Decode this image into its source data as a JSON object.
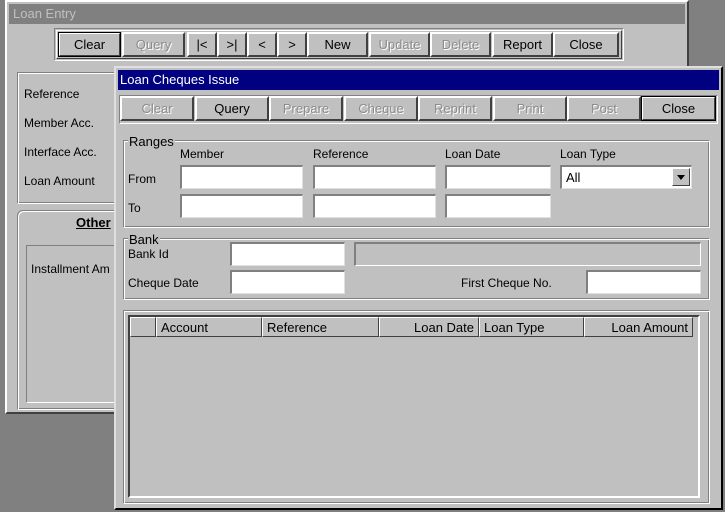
{
  "back_window": {
    "title": "Loan Entry",
    "toolbar": [
      {
        "label": "Clear",
        "enabled": true,
        "focused": true
      },
      {
        "label": "Query",
        "enabled": false
      },
      {
        "label": "|<",
        "enabled": true
      },
      {
        "label": ">|",
        "enabled": true
      },
      {
        "label": "<",
        "enabled": true
      },
      {
        "label": ">",
        "enabled": true
      },
      {
        "label": "New",
        "enabled": true
      },
      {
        "label": "Update",
        "enabled": false
      },
      {
        "label": "Delete",
        "enabled": false
      },
      {
        "label": "Report",
        "enabled": true
      },
      {
        "label": "Close",
        "enabled": true
      }
    ],
    "fields": {
      "reference": "Reference",
      "member_acc": "Member Acc.",
      "interface_acc": "Interface Acc.",
      "loan_amount": "Loan Amount"
    },
    "tab_label": "Other",
    "installment_label": "Installment Am"
  },
  "front_window": {
    "title": "Loan Cheques Issue",
    "toolbar": [
      {
        "label": "Clear",
        "enabled": false
      },
      {
        "label": "Query",
        "enabled": true
      },
      {
        "label": "Prepare",
        "enabled": false
      },
      {
        "label": "Cheque",
        "enabled": false
      },
      {
        "label": "Reprint",
        "enabled": false
      },
      {
        "label": "Print",
        "enabled": false
      },
      {
        "label": "Post",
        "enabled": false
      },
      {
        "label": "Close",
        "enabled": true,
        "focused": true
      }
    ],
    "ranges": {
      "title": "Ranges",
      "col_member": "Member",
      "col_reference": "Reference",
      "col_loan_date": "Loan Date",
      "col_loan_type": "Loan Type",
      "row_from": "From",
      "row_to": "To",
      "loan_type_value": "All"
    },
    "bank": {
      "title": "Bank",
      "bank_id_label": "Bank Id",
      "cheque_date_label": "Cheque Date",
      "first_cheque_label": "First Cheque No."
    },
    "grid": {
      "columns": [
        "Account",
        "Reference",
        "Loan Date",
        "Loan Type",
        "Loan Amount"
      ]
    }
  }
}
